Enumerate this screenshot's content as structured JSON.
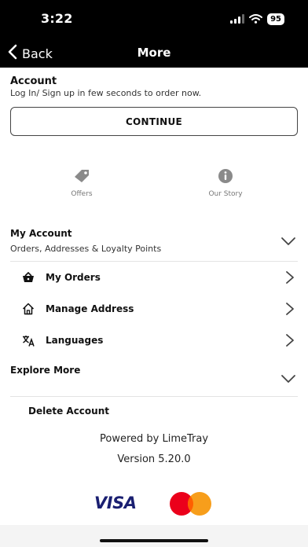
{
  "status": {
    "time": "3:22",
    "battery": "95"
  },
  "nav": {
    "back_label": "Back",
    "title": "More"
  },
  "account": {
    "title": "Account",
    "subtitle": "Log In/ Sign up in few seconds to order now.",
    "continue_label": "CONTINUE"
  },
  "quick_links": [
    {
      "label": "Offers",
      "icon": "tag-icon"
    },
    {
      "label": "Our Story",
      "icon": "info-icon"
    }
  ],
  "my_account": {
    "title": "My Account",
    "subtitle": "Orders, Addresses & Loyalty Points",
    "items": [
      {
        "label": "My Orders",
        "icon": "basket-icon"
      },
      {
        "label": "Manage Address",
        "icon": "home-icon"
      },
      {
        "label": "Languages",
        "icon": "translate-icon"
      }
    ]
  },
  "explore": {
    "title": "Explore More"
  },
  "delete_label": "Delete Account",
  "footer": {
    "powered_by": "Powered by LimeTray",
    "version": "Version 5.20.0",
    "visa_label": "VISA"
  },
  "colors": {
    "header_bg": "#000000",
    "visa_blue": "#1a1f71",
    "mc_red": "#eb001b",
    "mc_orange": "#f79e1b"
  }
}
